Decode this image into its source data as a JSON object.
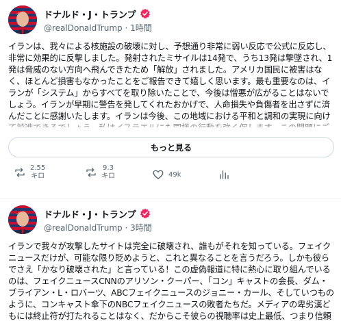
{
  "post1": {
    "display_name": "ドナルド・J・トランプ",
    "handle": "@realDonaldTrump",
    "time": "1時間",
    "body": "イランは、我々による核施設の破壊に対し、予想通り非常に弱い反応で公式に反応し、非常に効果的に反撃しました。発射されたミサイルは14発で、うち13発は撃墜され、1発は脅威のない方向へ飛んできたため「解放」されました。アメリカ国民に被害はなく、ほとんど損害もなかったことをご報告できて嬉しく思います。最も重要なのは、イランが「システム」からすべてを取り除いたことで、今後は憎悪が広がることはないでしょう。イランが早期に警告を発してくれたおかげで、人命損失や負傷者を出さずに済んだことに感謝いたします。イランは今後、この地域における平和と調和の実現に向けて前進できるでしょう。私はイスラエルにも同様の行動を強く促します。この問題にご関心をお寄せいただき、ありがとうございます。",
    "show_more_label": "もっと見る",
    "stats": {
      "reposts_value": "2.55",
      "reposts_unit": "キロ",
      "likes_value": "9.3",
      "likes_unit": "キロ",
      "views": "49k"
    }
  },
  "post2": {
    "display_name": "ドナルド・J・トランプ",
    "handle": "@realDonaldTrump",
    "time": "3時間",
    "body": "イランで我々が攻撃したサイトは完全に破壊され、誰もがそれを知っている。フェイクニュースだけが、可能な限り貶めようと、これと異なることを言うだろう。しかも彼らでさえ「かなり破壊された」と言っている！この虚偽報道に特に熱心に取り組んでいるのは、フェイクニュースCNNのアリソン・クーパー、「コン」キャストの会長、ダム・ブライアン・L・ロバーツ、ABCフェイクニュースのジョニー・カール、そしていつものように、コンキャスト傘下のNBCフェイクニュースの敗者たちだ。メディアの卑劣漢どもには終止符が打たれることはなく、だからこそ彼らの視聴率は史上最低、つまり信頼性ゼロなのだ！"
  },
  "colors": {
    "verified": "#f4245e",
    "text": "#0f1419",
    "muted": "#536471",
    "border": "#cfd9de"
  },
  "icons": [
    "verified-badge-icon",
    "repost-icon",
    "like-icon",
    "views-icon"
  ]
}
